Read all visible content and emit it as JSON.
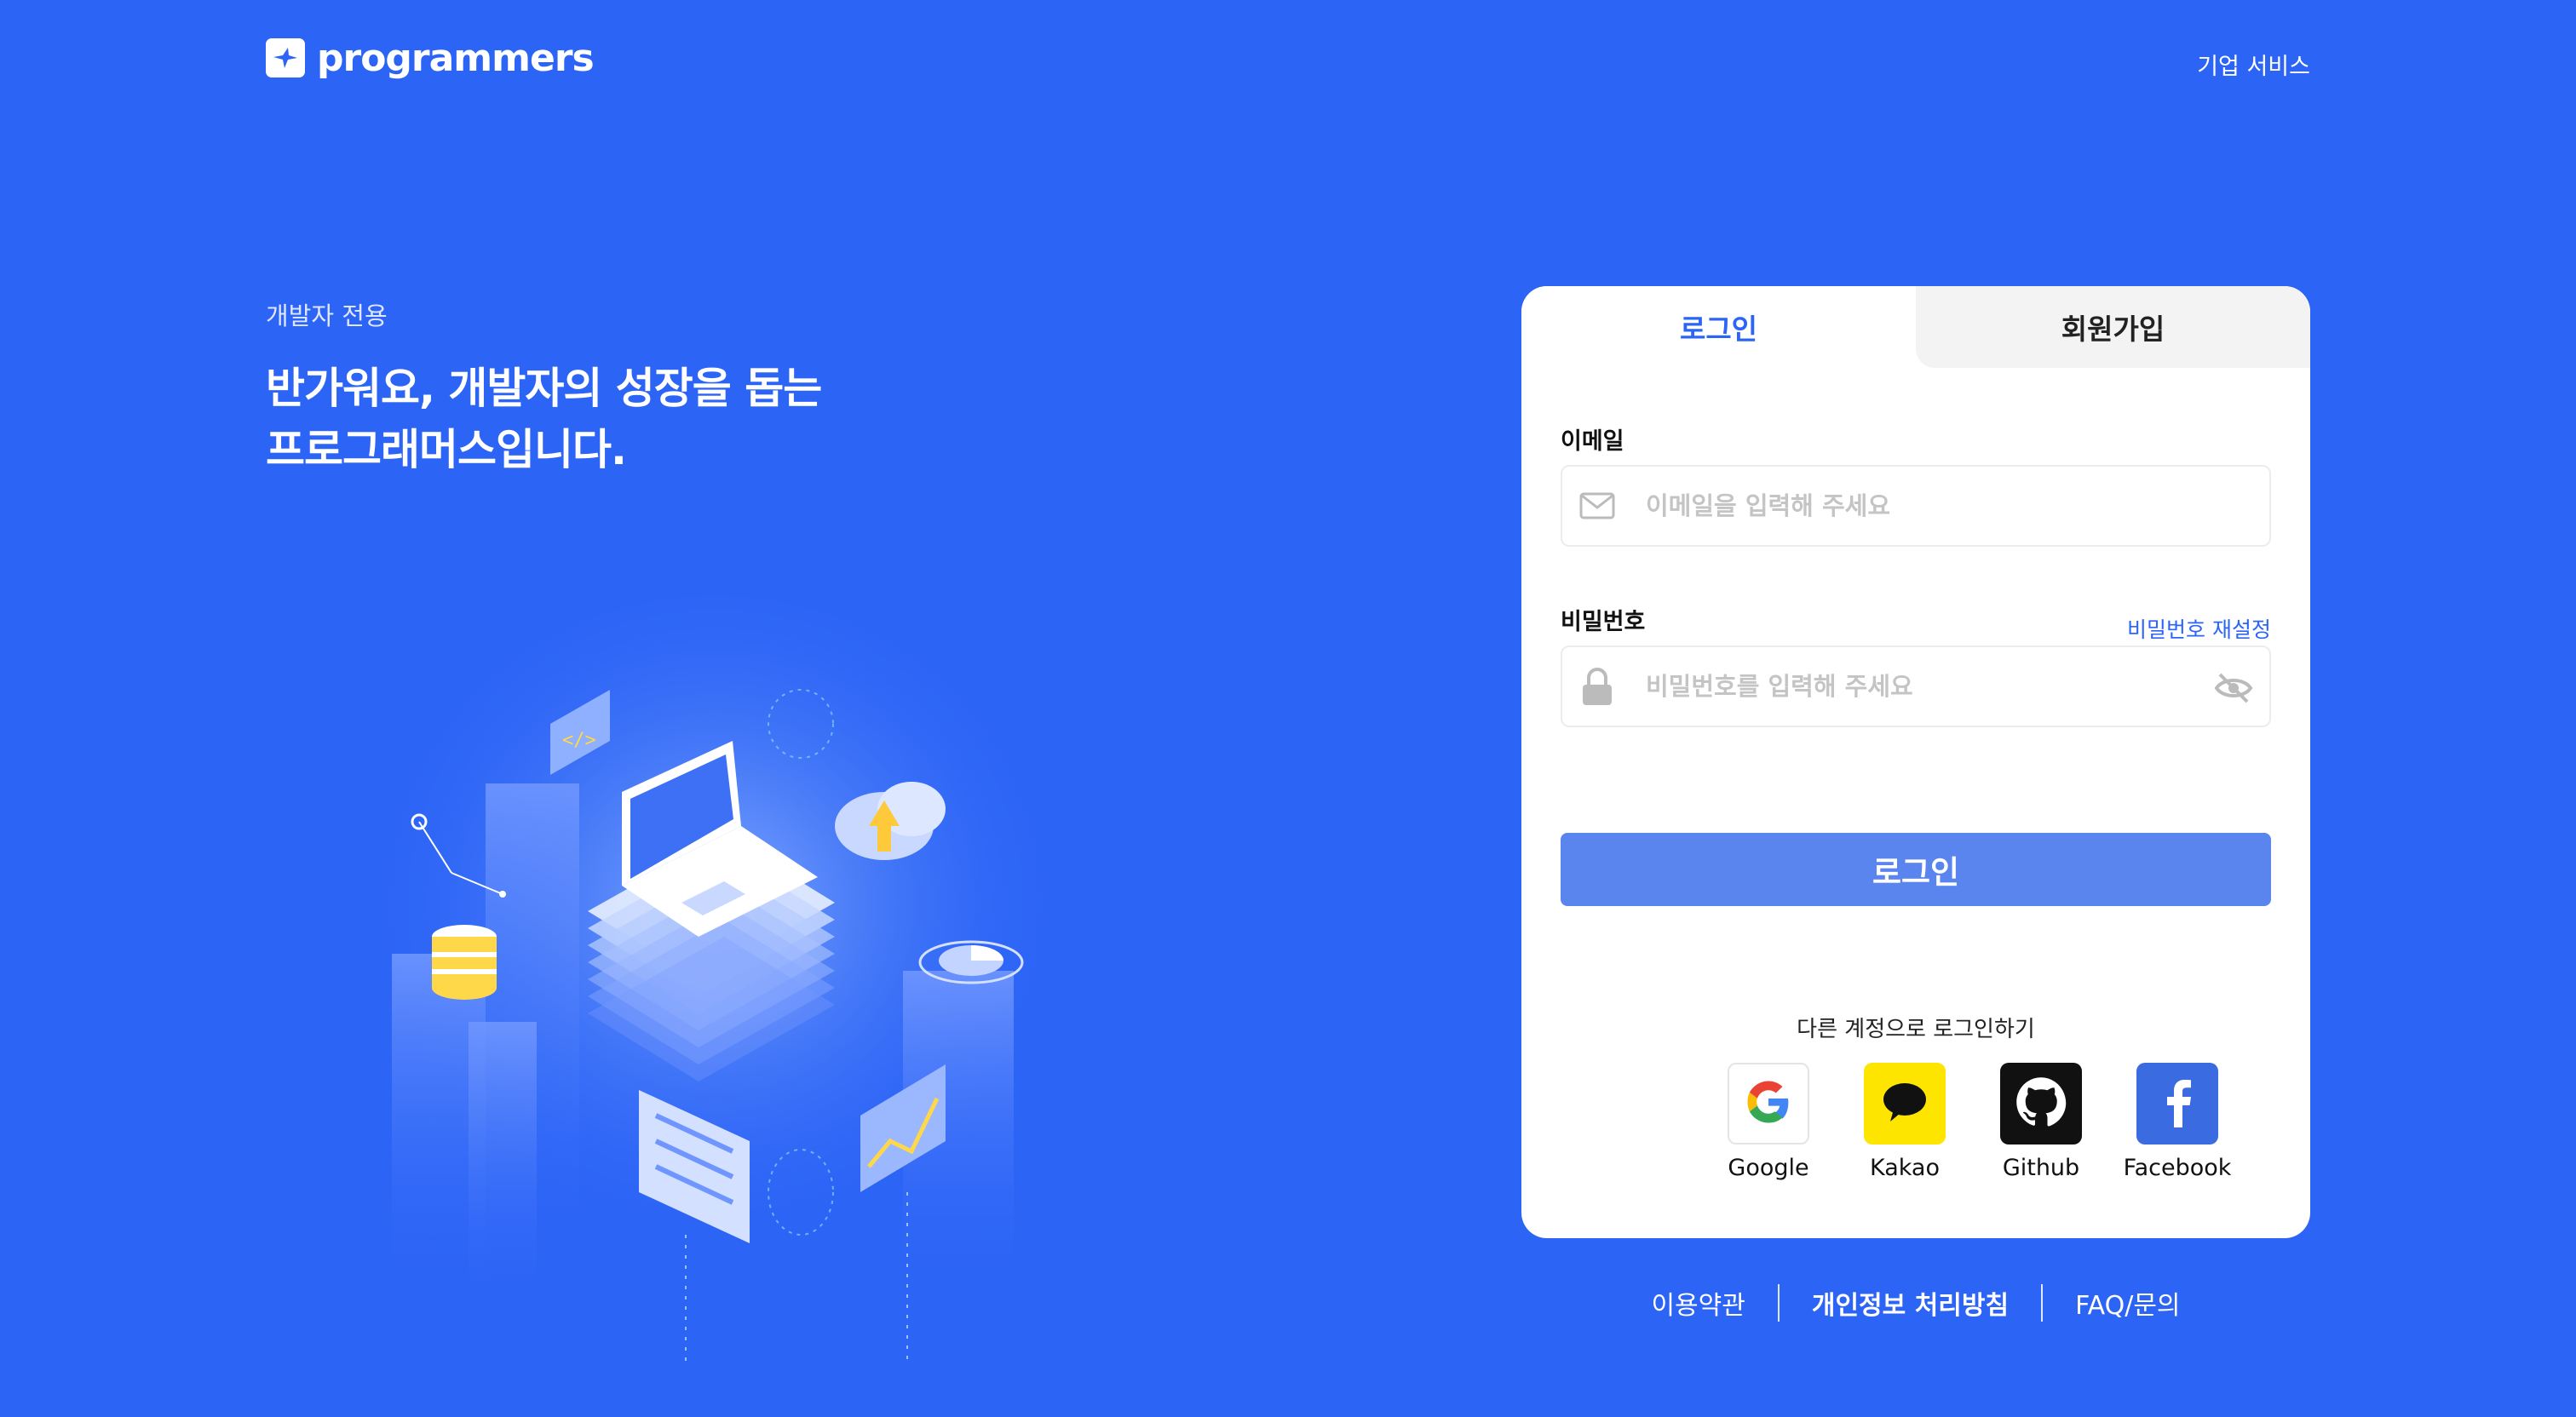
{
  "header": {
    "brand": "programmers",
    "business_link": "기업 서비스"
  },
  "intro": {
    "eyebrow": "개발자 전용",
    "title_line1": "반가워요, 개발자의 성장을 돕는",
    "title_line2": "프로그래머스입니다."
  },
  "card": {
    "tabs": [
      {
        "label": "로그인",
        "active": true
      },
      {
        "label": "회원가입",
        "active": false
      }
    ],
    "email": {
      "label": "이메일",
      "placeholder": "이메일을 입력해 주세요",
      "value": "",
      "icon": "mail-icon"
    },
    "password": {
      "label": "비밀번호",
      "placeholder": "비밀번호를 입력해 주세요",
      "value": "",
      "icon": "lock-icon",
      "toggle_icon": "eye-off-icon",
      "reset_link": "비밀번호 재설정"
    },
    "login_button": "로그인",
    "social_title": "다른 계정으로 로그인하기",
    "social": [
      {
        "label": "Google",
        "icon": "google-icon"
      },
      {
        "label": "Kakao",
        "icon": "kakao-icon",
        "color": "#fee500"
      },
      {
        "label": "Github",
        "icon": "github-icon",
        "color": "#111111"
      },
      {
        "label": "Facebook",
        "icon": "facebook-icon",
        "color": "#3b6be0"
      }
    ]
  },
  "footer": {
    "terms": "이용약관",
    "privacy": "개인정보 처리방침",
    "faq": "FAQ/문의"
  },
  "colors": {
    "background": "#2c64f6",
    "accent": "#2c64f6",
    "login_button": "#5a85ee"
  }
}
